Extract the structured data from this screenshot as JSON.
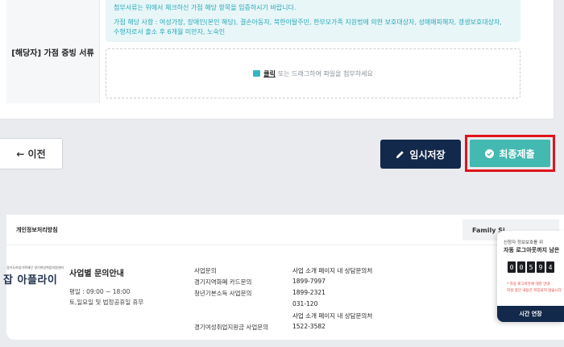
{
  "form": {
    "row_label": "[해당자] 가점 증빙 서류",
    "notice_line1": "첨부서류는 위에서 체크하신 가점 해당 항목을 입증하시기 바랍니다.",
    "notice_line2": "가점 해당 사항 : 여성가장, 장애인(본인 해당), 결손아동자, 북한이탈주민, 한부모가족 지원법에 의한 보호대상자, 성매매피해자, 갱생보호대상자,",
    "notice_line3": "수형자로서 출소 후 6개월 미만자, 노숙인",
    "upload_link": "클릭",
    "upload_text": "또는 드래그하여 파일을 첨부하세요"
  },
  "actions": {
    "prev_label": "← 이전",
    "save_label": "임시저장",
    "submit_label": "최종제출"
  },
  "footer": {
    "privacy_link": "개인정보처리방침",
    "family_site": "Family Si",
    "logo_small": "경기도여성가족재단 경기여성취업지원센터",
    "logo_text": "잡 아플라이",
    "biz_title": "사업별 문의안내",
    "hours_line1": "평일 : 09:00 ~ 18:00",
    "hours_line2": "토,일요일 및 법정공휴일 휴무",
    "contacts": [
      {
        "label": "사업문의",
        "value": "사업 소개 페이지 내 상담문의처"
      },
      {
        "label": "경기지역화폐 카드문의",
        "value": "1899-7997"
      },
      {
        "label": "청년기본소득 사업문의",
        "value": "1899-2321"
      },
      {
        "label": "",
        "value": "031-120"
      },
      {
        "label": "",
        "value": "사업 소개 페이지 내 상담문의처"
      },
      {
        "label": "경기여성취업지원금 사업문의",
        "value": "1522-3582"
      }
    ]
  },
  "session": {
    "line1": "신청자 정보보호를 위",
    "line2": "자동 로그아웃까지 남은",
    "digits": [
      "0",
      "0",
      "5",
      "9",
      "4"
    ],
    "warn1": "* 자동 로그아웃에 대한 안내",
    "warn2": "작성 중인 내용은 저장되지 않습니다",
    "extend_label": "시간 연장"
  }
}
